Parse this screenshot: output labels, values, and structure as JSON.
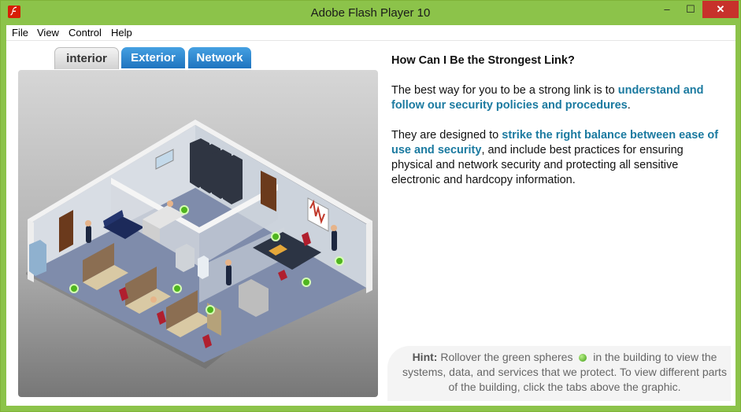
{
  "window": {
    "title": "Adobe Flash Player 10",
    "minimize": "‒",
    "maximize": "☐",
    "close": "✕"
  },
  "menu": [
    "File",
    "View",
    "Control",
    "Help"
  ],
  "tabs": [
    {
      "label": "interior",
      "active": true
    },
    {
      "label": "Exterior",
      "active": false
    },
    {
      "label": "Network",
      "active": false
    }
  ],
  "panel": {
    "heading": "How Can I Be the Strongest Link?",
    "p1_lead": "The best way for you to be a strong link is to ",
    "p1_em": "understand and follow our security policies and procedures",
    "p1_tail": ".",
    "p2_lead": "They are designed to ",
    "p2_em": "strike the right balance between ease of use and security",
    "p2_tail": ", and include best practices for ensuring physical and network security and protecting all sensitive electronic and hardcopy information."
  },
  "hint": {
    "label": "Hint:",
    "text_before": " Rollover the green spheres ",
    "text_after": " in the building to view the systems, data, and services that we protect. To view different parts of the building, click the tabs above the graphic."
  },
  "colors": {
    "titlebar": "#8cc34a",
    "tab_active": "#d2d2d2",
    "tab_inactive": "#1f74bf",
    "emphasis": "#1b7aa0",
    "sphere": "#3f9c12"
  }
}
